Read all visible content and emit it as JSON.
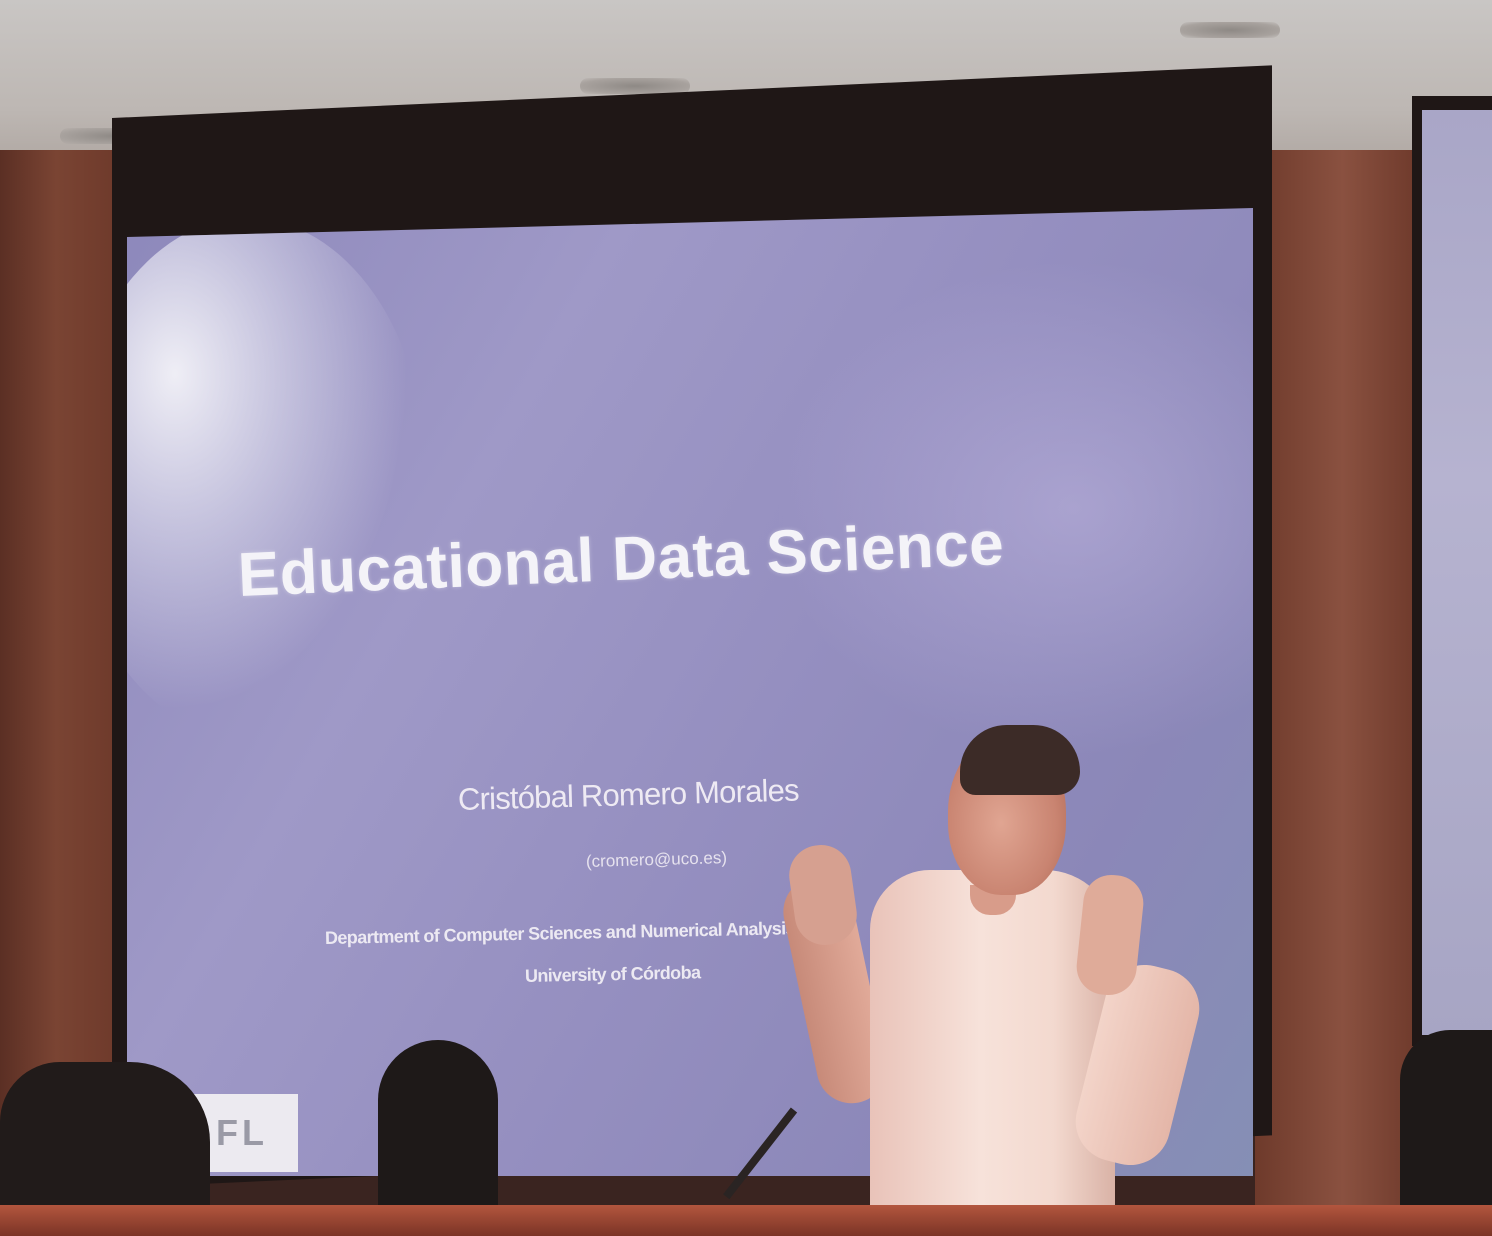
{
  "slide": {
    "title": "Educational Data Science",
    "author": "Cristóbal Romero Morales",
    "email": "(cromero@uco.es)",
    "department": "Department of Computer Sciences and Numerical Analysis",
    "university": "University of Córdoba",
    "logo_text": "FL"
  },
  "colors": {
    "slide_background": "#958fc0",
    "slide_text": "#f4f3f8",
    "wood_panel": "#7a4433",
    "ceiling": "#c9c6c4"
  }
}
